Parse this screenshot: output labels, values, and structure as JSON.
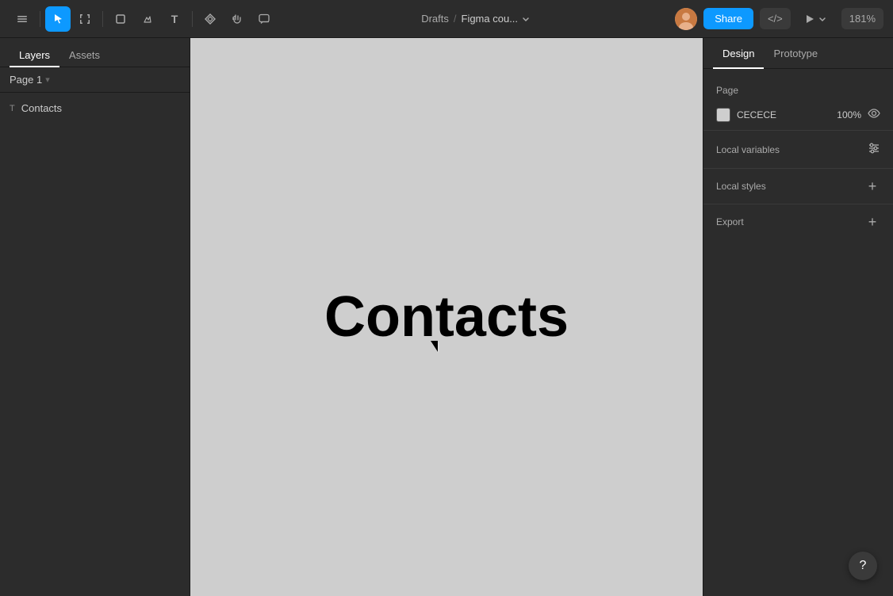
{
  "toolbar": {
    "tools": [
      {
        "id": "main-menu",
        "icon": "☰",
        "label": "Main menu"
      },
      {
        "id": "select",
        "icon": "▲",
        "label": "Select tool",
        "active": true
      },
      {
        "id": "frame",
        "icon": "⊞",
        "label": "Frame tool"
      },
      {
        "id": "shape",
        "icon": "◻",
        "label": "Shape tool"
      },
      {
        "id": "pen",
        "icon": "✒",
        "label": "Pen tool"
      },
      {
        "id": "text",
        "icon": "T",
        "label": "Text tool"
      },
      {
        "id": "components",
        "icon": "❖",
        "label": "Components"
      },
      {
        "id": "hand",
        "icon": "✋",
        "label": "Hand tool"
      },
      {
        "id": "comment",
        "icon": "💬",
        "label": "Comment tool"
      }
    ],
    "breadcrumb_drafts": "Drafts",
    "breadcrumb_sep": "/",
    "breadcrumb_title": "Figma cou...",
    "share_label": "Share",
    "code_label": "</>",
    "zoom_label": "181%"
  },
  "left_panel": {
    "tabs": [
      {
        "id": "layers",
        "label": "Layers",
        "active": true
      },
      {
        "id": "assets",
        "label": "Assets"
      }
    ],
    "page_selector": {
      "label": "Page 1",
      "chevron": "▾"
    },
    "layers": [
      {
        "id": "contacts-layer",
        "icon": "T",
        "label": "Contacts"
      }
    ]
  },
  "canvas": {
    "bg_color": "#cecece",
    "text": "Contacts"
  },
  "right_panel": {
    "tabs": [
      {
        "id": "design",
        "label": "Design",
        "active": true
      },
      {
        "id": "prototype",
        "label": "Prototype"
      }
    ],
    "page_section": {
      "label": "Page"
    },
    "page_bg": {
      "color": "#CECECE",
      "color_label": "CECECE",
      "opacity": "100%"
    },
    "local_variables": {
      "label": "Local variables",
      "tune_icon": "⚙"
    },
    "local_styles": {
      "label": "Local styles",
      "plus_icon": "+"
    },
    "export": {
      "label": "Export",
      "plus_icon": "+"
    }
  },
  "help_btn": {
    "label": "?"
  }
}
